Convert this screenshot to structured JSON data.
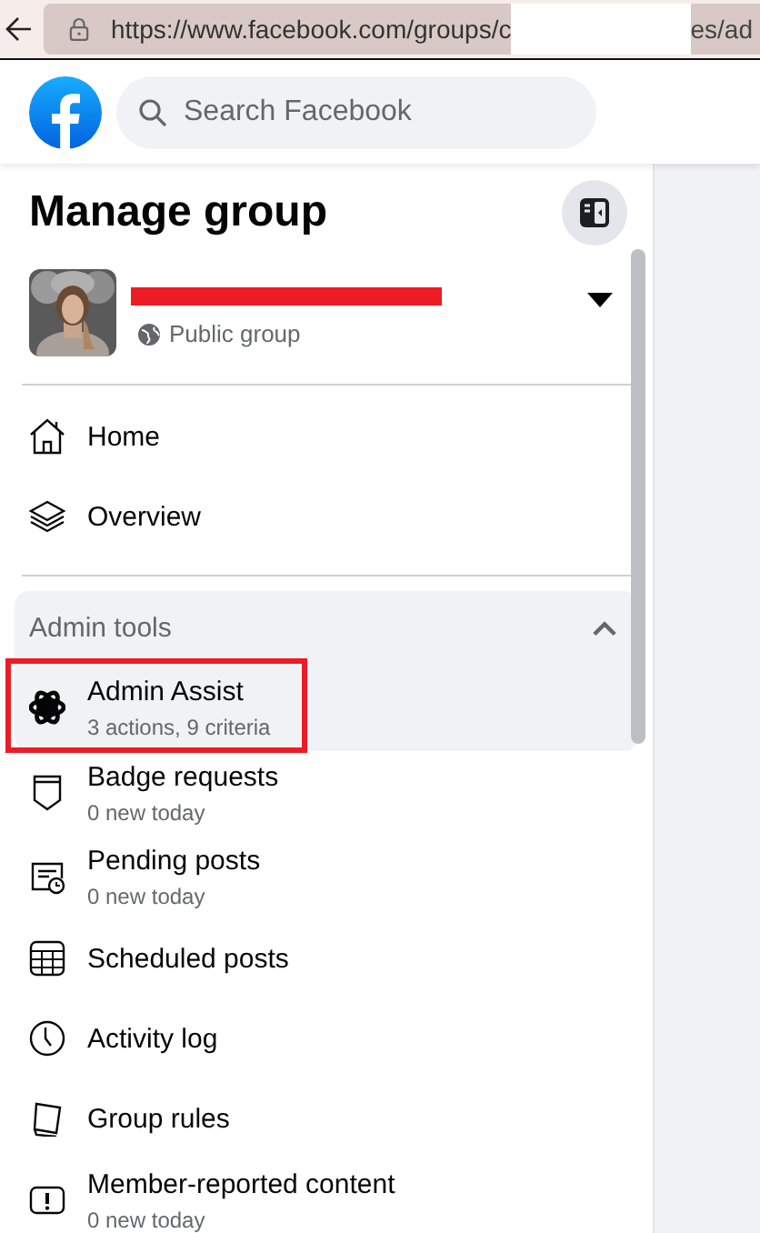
{
  "browser": {
    "url_start": "https://www.facebook.com/groups/c",
    "url_end": "es/ad"
  },
  "header": {
    "search": {
      "placeholder": "Search Facebook"
    }
  },
  "sidebar": {
    "title": "Manage group",
    "group": {
      "visibility": "Public group",
      "name_redacted": true
    },
    "nav_items": [
      {
        "label": "Home"
      },
      {
        "label": "Overview"
      }
    ],
    "admin_tools": {
      "label": "Admin tools",
      "expanded": true,
      "items": [
        {
          "label": "Admin Assist",
          "detail": "3 actions, 9 criteria",
          "selected": true,
          "highlighted": true
        },
        {
          "label": "Badge requests",
          "detail": "0 new today",
          "selected": false,
          "highlighted": false
        },
        {
          "label": "Pending posts",
          "detail": "0 new today",
          "selected": false,
          "highlighted": false
        },
        {
          "label": "Scheduled posts",
          "selected": false,
          "highlighted": false
        },
        {
          "label": "Activity log",
          "selected": false,
          "highlighted": false
        },
        {
          "label": "Group rules",
          "selected": false,
          "highlighted": false
        },
        {
          "label": "Member-reported content",
          "detail": "0 new today",
          "selected": false,
          "highlighted": false
        }
      ]
    }
  }
}
